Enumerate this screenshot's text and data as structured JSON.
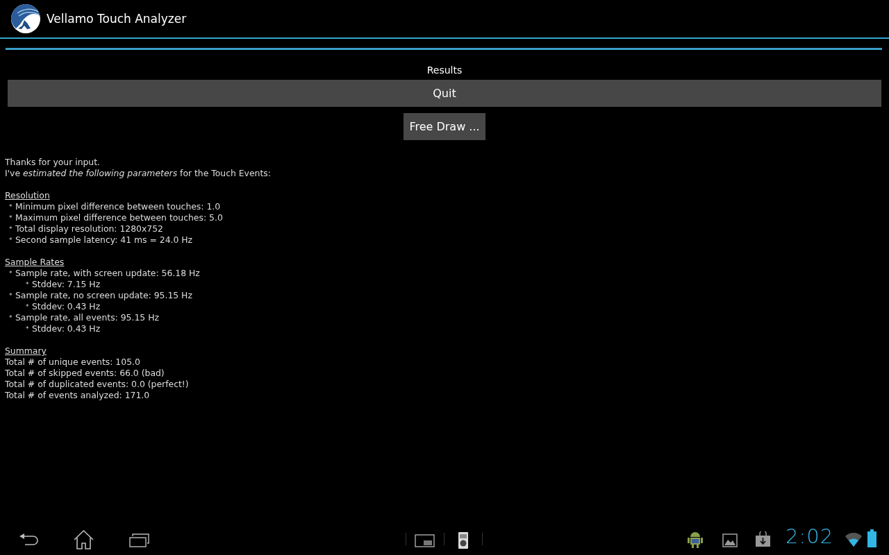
{
  "action_bar": {
    "title": "Vellamo Touch Analyzer"
  },
  "progress": {
    "level": 1
  },
  "results_label": "Results",
  "buttons": [
    {
      "label": "Quit",
      "kind": "wide"
    },
    {
      "label": "Free Draw ...",
      "kind": "compact"
    }
  ],
  "intro": [
    "Thanks for your input.",
    "I've *estimated the following parameters* for the Touch Events:"
  ],
  "sections": [
    {
      "heading": "Resolution",
      "items": [
        {
          "text": "Minimum pixel difference between touches: 1.0",
          "kind": "bullet"
        },
        {
          "text": "Maximum pixel difference between touches: 5.0",
          "kind": "bullet"
        },
        {
          "text": "Total display resolution: 1280x752",
          "kind": "bullet"
        },
        {
          "text": "Second sample latency: 41 ms = 24.0 Hz",
          "kind": "bullet"
        }
      ]
    },
    {
      "heading": "Sample Rates",
      "items": [
        {
          "text": "Sample rate, with screen update: 56.18 Hz",
          "kind": "bullet",
          "children": [
            {
              "text": "Stddev: 7.15 Hz",
              "kind": "bullet"
            }
          ]
        },
        {
          "text": "Sample rate, no screen update: 95.15 Hz",
          "kind": "bullet",
          "children": [
            {
              "text": "Stddev: 0.43 Hz",
              "kind": "bullet"
            }
          ]
        },
        {
          "text": "Sample rate, all events: 95.15 Hz",
          "kind": "bullet",
          "children": [
            {
              "text": "Stddev: 0.43 Hz",
              "kind": "bullet"
            }
          ]
        }
      ]
    },
    {
      "heading": "Summary",
      "items": [
        {
          "text": "Total # of unique events: 105.0",
          "kind": "plain"
        },
        {
          "text": "Total # of skipped events: 66.0 (bad)",
          "kind": "plain"
        },
        {
          "text": "Total # of duplicated events: 0.0 (perfect!)",
          "kind": "plain"
        },
        {
          "text": "Total # of events analyzed: 171.0",
          "kind": "plain"
        }
      ]
    }
  ],
  "bullet_glyph": "*",
  "system_bar": {
    "clock": "2:02"
  }
}
